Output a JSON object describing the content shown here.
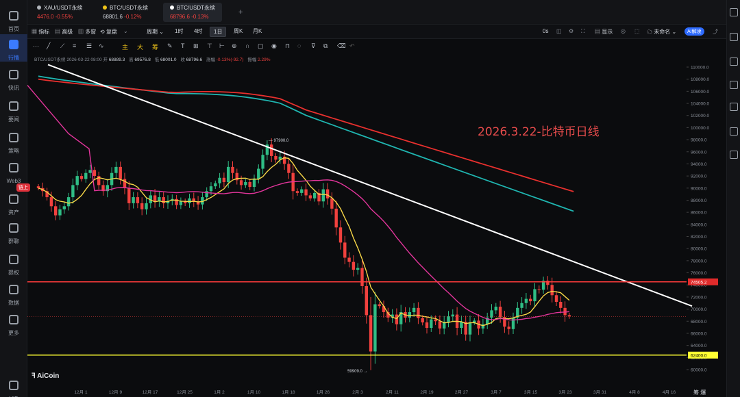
{
  "nav": [
    {
      "label": "首页",
      "icon": "home-icon"
    },
    {
      "label": "行情",
      "icon": "chart-icon",
      "active": true
    },
    {
      "label": "快讯",
      "icon": "news-icon"
    },
    {
      "label": "要闻",
      "icon": "document-icon"
    },
    {
      "label": "策略",
      "icon": "robot-icon"
    },
    {
      "label": "Web3",
      "icon": "web3-icon"
    },
    {
      "label": "资产",
      "icon": "wallet-icon"
    },
    {
      "label": "群聊",
      "icon": "chat-icon"
    },
    {
      "label": "提权",
      "icon": "bag-icon"
    },
    {
      "label": "数据",
      "icon": "data-icon"
    },
    {
      "label": "更多",
      "icon": "grid-icon"
    },
    {
      "label": "VIP",
      "icon": "vip-icon"
    }
  ],
  "nav_badge": "链上",
  "tabs": [
    {
      "name": "XAU/USDT永续",
      "price": "4476.0",
      "change": "-0.55%",
      "dot": "#b0b4bb"
    },
    {
      "name": "BTC/USDT永续",
      "price": "68801.6",
      "change": "-0.12%",
      "dot": "#f0c419"
    },
    {
      "name": "BTC/USDT永续",
      "price": "68796.6",
      "change": "-0.13%",
      "dot": "#ffffff",
      "active": true
    }
  ],
  "add_tab": "+",
  "toolbar": {
    "indicator": "指标",
    "advanced": "高级",
    "multi": "多窗",
    "review": "复盘",
    "period": "周期",
    "intervals": [
      "1时",
      "4时",
      "1日",
      "周K",
      "月K"
    ],
    "active_interval": "1日",
    "countdown": "0s",
    "display": "显示",
    "unnamed": "未命名",
    "ai": "AI解读"
  },
  "drawtools": [
    "主",
    "大",
    "筹"
  ],
  "info": {
    "symbol": "BTC/USDT永续",
    "time": "2026-03-22 08:00",
    "open_label": "开",
    "open": "68889.3",
    "high_label": "高",
    "high": "69576.8",
    "low_label": "低",
    "low": "68001.0",
    "close_label": "收",
    "close": "68796.6",
    "change_label": "涨幅",
    "change": "-0.13%(-92.7)",
    "amp_label": "振幅",
    "amp": "2.29%"
  },
  "annotation_title": "2026.3.22-比特币日线",
  "logo": "AiCoin",
  "corner_right": "筹 爆",
  "colors": {
    "up": "#2fbd85",
    "down": "#f0413e",
    "ma_yellow": "#f5d547",
    "ma_pink": "#e2359b",
    "ma_teal": "#1fb5b0",
    "ma_red": "#e8302e",
    "trendline": "#ffffff",
    "level_red": "#ff3b3b",
    "level_yellow": "#ffff33"
  },
  "chart_data": {
    "type": "candlestick",
    "y_ticks": [
      60000,
      62000,
      64000,
      66000,
      68000,
      70000,
      72000,
      74000,
      76000,
      78000,
      80000,
      82000,
      84000,
      86000,
      88000,
      90000,
      92000,
      94000,
      96000,
      98000,
      100000,
      102000,
      104000,
      106000,
      108000,
      110000
    ],
    "y_tick_labels": [
      "60000.0",
      "62000.0",
      "64000.0",
      "66000.0",
      "68000.0",
      "70000.0",
      "72000.0",
      "74000.0",
      "76000.0",
      "78000.0",
      "80000.0",
      "82000.0",
      "84000.0",
      "86000.0",
      "88000.0",
      "90000.0",
      "92000.0",
      "94000.0",
      "96000.0",
      "98000.0",
      "100000.0",
      "102000.0",
      "104000.0",
      "106000.0",
      "108000.0",
      "110000.0"
    ],
    "x_labels": [
      "12月 1",
      "12月 9",
      "12月 17",
      "12月 25",
      "1月 2",
      "1月 10",
      "1月 18",
      "1月 26",
      "2月 3",
      "2月 11",
      "2月 19",
      "2月 27",
      "3月 7",
      "3月 15",
      "3月 23",
      "3月 31",
      "4月 8",
      "4月 16"
    ],
    "levels": [
      {
        "value": 74505.2,
        "label": "74505.2",
        "color": "red"
      },
      {
        "value": 62400.0,
        "label": "62400.0",
        "color": "yellow"
      }
    ],
    "current_price": 68796.6,
    "annotations": [
      {
        "text": "97900.0",
        "value": 97900
      },
      {
        "text": "59909.0",
        "value": 59909
      }
    ],
    "closes": [
      90000,
      89500,
      88500,
      87000,
      85500,
      86500,
      87000,
      88500,
      90500,
      92000,
      91500,
      92500,
      93000,
      92000,
      90500,
      89500,
      90500,
      92500,
      93500,
      91500,
      90000,
      87500,
      88500,
      87500,
      86500,
      87500,
      88800,
      87800,
      88500,
      87500,
      87900,
      88200,
      87200,
      87800,
      87500,
      88300,
      87800,
      87300,
      88500,
      89500,
      90300,
      90800,
      91700,
      91000,
      93500,
      92500,
      91300,
      90500,
      91000,
      90200,
      91500,
      93200,
      95500,
      97200,
      95300,
      94700,
      95200,
      94000,
      92500,
      89500,
      89200,
      89800,
      88800,
      88300,
      89200,
      87800,
      89800,
      88300,
      86600,
      83500,
      81000,
      78500,
      77800,
      76500,
      76800,
      73800,
      69000,
      63000,
      70800,
      70500,
      69500,
      68600,
      69100,
      67500,
      69500,
      68600,
      69500,
      70200,
      68500,
      67800,
      66900,
      68300,
      68000,
      66800,
      67900,
      68800,
      69100,
      66900,
      67900,
      65800,
      67800,
      68100,
      66800,
      67500,
      68600,
      69800,
      70400,
      68700,
      67100,
      66700,
      68600,
      70200,
      71000,
      71700,
      71300,
      73300,
      73200,
      74700,
      74000,
      72300,
      71200,
      70200,
      69000,
      68797
    ]
  }
}
